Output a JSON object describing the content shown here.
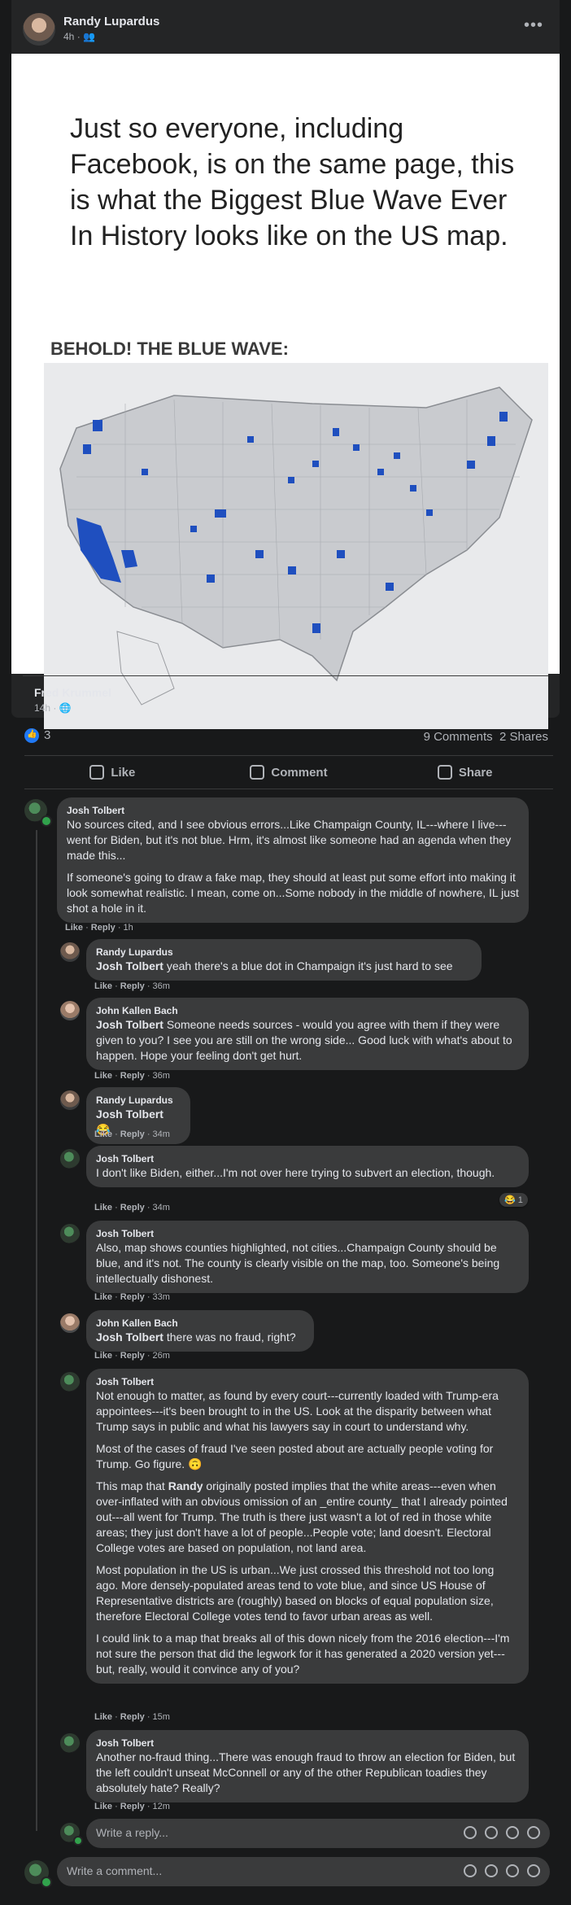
{
  "post": {
    "author": "Randy Lupardus",
    "time": "4h",
    "audience_icon": "friends-icon",
    "image": {
      "headline": "Just so everyone, including Facebook, is on the same page, this is what the Biggest Blue Wave Ever In History looks like on the US map.",
      "subheading": "BEHOLD! THE BLUE WAVE:"
    },
    "shared_from": {
      "name": "Fred Krummel",
      "time": "14h"
    },
    "reactions_count": "3",
    "comments_count": "9 Comments",
    "shares_count": "2 Shares",
    "actions": {
      "like": "Like",
      "comment": "Comment",
      "share": "Share"
    }
  },
  "colors": {
    "bg": "#18191a",
    "card": "#242526",
    "bubble": "#3a3b3c",
    "like_blue": "#2078f4",
    "online": "#31a24c",
    "map_blue": "#1f4fbf"
  },
  "comments": [
    {
      "name": "Josh Tolbert",
      "paragraphs": [
        "No sources cited, and I see obvious errors...Like Champaign County, IL---where I live---went for Biden, but it's not blue. Hrm, it's almost like someone had an agenda when they made this...",
        "If someone's going to draw a fake map, they should at least put some effort into making it look somewhat realistic. I mean, come on...Some nobody in the middle of nowhere, IL just shot a hole in it."
      ],
      "like": "Like",
      "reply": "Reply",
      "time": "1h"
    }
  ],
  "replies": [
    {
      "name": "Randy Lupardus",
      "tag": "Josh Tolbert",
      "text": " yeah there's a blue dot in Champaign it's just hard to see",
      "like": "Like",
      "reply": "Reply",
      "time": "36m"
    },
    {
      "name": "John Kallen Bach",
      "tag": "Josh Tolbert",
      "text": " Someone needs sources - would you agree with them if they were given to you? I see you are still on the wrong side... Good luck with what's about to happen. Hope your feeling don't get hurt.",
      "like": "Like",
      "reply": "Reply",
      "time": "36m"
    },
    {
      "name": "Randy Lupardus",
      "tag": "Josh Tolbert",
      "text": " 😂",
      "like": "Like",
      "reply": "Reply",
      "time": "34m"
    },
    {
      "name": "Josh Tolbert",
      "tag": "",
      "text": "I don't like Biden, either...I'm not over here trying to subvert an election, though.",
      "reaction": "😂 1",
      "like": "Like",
      "reply": "Reply",
      "time": "34m"
    },
    {
      "name": "Josh Tolbert",
      "tag": "",
      "text": "Also, map shows counties highlighted, not cities...Champaign County should be blue, and it's not. The county is clearly visible on the map, too. Someone's being intellectually dishonest.",
      "like": "Like",
      "reply": "Reply",
      "time": "33m"
    },
    {
      "name": "John Kallen Bach",
      "tag": "Josh Tolbert",
      "text": " there was no fraud, right?",
      "like": "Like",
      "reply": "Reply",
      "time": "26m"
    },
    {
      "name": "Josh Tolbert",
      "p1": "Not enough to matter, as found by every court---currently loaded with Trump-era appointees---it's been brought to in the US. Look at the disparity between what Trump says in public and what his lawyers say in court to understand why.",
      "p2": "Most of the cases of fraud I've seen posted about are actually people voting for Trump. Go figure. 🙃",
      "p3a": "This map that ",
      "p3tag": "Randy",
      "p3b": " originally posted implies that the white areas---even when over-inflated with an obvious omission of an _entire county_ that I already pointed out---all went for Trump. The truth is there just wasn't a lot of red in those white areas; they just don't have a lot of people...People vote; land doesn't. Electoral College votes are based on population, not land area.",
      "p4": "Most population in the US is urban...We just crossed this threshold not too long ago. More densely-populated areas tend to vote blue, and since US House of Representative districts are (roughly) based on blocks of equal population size, therefore Electoral College votes tend to favor urban areas as well.",
      "p5": "I could link to a map that breaks all of this down nicely from the 2016 election---I'm not sure the person that did the legwork for it has generated a 2020 version yet---but, really, would it convince any of you?",
      "like": "Like",
      "reply": "Reply",
      "time": "15m"
    },
    {
      "name": "Josh Tolbert",
      "tag": "",
      "text": "Another no-fraud thing...There was enough fraud to throw an election for Biden, but the left couldn't unseat McConnell or any of the other Republican toadies they absolutely hate? Really?",
      "like": "Like",
      "reply": "Reply",
      "time": "12m"
    }
  ],
  "reply_input": {
    "placeholder": "Write a reply..."
  },
  "comment_input": {
    "placeholder": "Write a comment..."
  }
}
